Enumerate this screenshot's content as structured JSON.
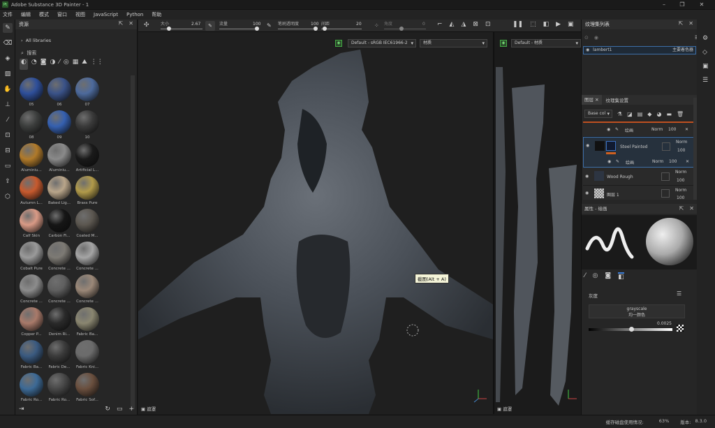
{
  "window": {
    "title": "Adobe Substance 3D Painter - 1",
    "logo": "Pt"
  },
  "menu": [
    "文件",
    "编辑",
    "模式",
    "窗口",
    "视图",
    "JavaScript",
    "Python",
    "帮助"
  ],
  "assets": {
    "title": "资源",
    "library": "All libraries",
    "search_placeholder": "搜索",
    "materials": [
      {
        "label": "05",
        "color": "#2e4f9a"
      },
      {
        "label": "06",
        "color": "#3a5288"
      },
      {
        "label": "07",
        "color": "#4d6a9c"
      },
      {
        "label": "08",
        "color": "#3c3e3d"
      },
      {
        "label": "09",
        "color": "#3560b0"
      },
      {
        "label": "10",
        "color": "#3a3a3a"
      },
      {
        "label": "Aluminiu...",
        "color": "#b07a2a"
      },
      {
        "label": "Aluminiu...",
        "color": "#8a8a8a"
      },
      {
        "label": "Artificial L...",
        "color": "#1a1a1a"
      },
      {
        "label": "Autumn L...",
        "color": "#c75a2e"
      },
      {
        "label": "Baked Lig...",
        "color": "#b9a58a"
      },
      {
        "label": "Brass Pure",
        "color": "#b19a4a"
      },
      {
        "label": "Calf Skin",
        "color": "#d99a86"
      },
      {
        "label": "Carbon Fi...",
        "color": "#161616"
      },
      {
        "label": "Coated M...",
        "color": "#5c5750"
      },
      {
        "label": "Cobalt Pure",
        "color": "#9a9a9a"
      },
      {
        "label": "Concrete ...",
        "color": "#7d7a74"
      },
      {
        "label": "Concrete ...",
        "color": "#a5a5a5"
      },
      {
        "label": "Concrete ...",
        "color": "#8c8c8c"
      },
      {
        "label": "Concrete ...",
        "color": "#5f5f5f"
      },
      {
        "label": "Concrete ...",
        "color": "#9b8878"
      },
      {
        "label": "Copper P...",
        "color": "#a97a6a"
      },
      {
        "label": "Denim Ri...",
        "color": "#2a2a2a"
      },
      {
        "label": "Fabric Ba...",
        "color": "#8a8670"
      },
      {
        "label": "Fabric Ba...",
        "color": "#3a5a80"
      },
      {
        "label": "Fabric De...",
        "color": "#3b3b3b"
      },
      {
        "label": "Fabric Kni...",
        "color": "#6b6b6b"
      },
      {
        "label": "Fabric Ro...",
        "color": "#3d6a96"
      },
      {
        "label": "Fabric Ro...",
        "color": "#474747"
      },
      {
        "label": "Fabric Sof...",
        "color": "#6a4f3e"
      }
    ]
  },
  "topbar": {
    "size_label": "大小",
    "size_value": "2.67",
    "flow_label": "流量",
    "flow_value": "100",
    "opacity_label": "笔刷透明度",
    "opacity_value": "100",
    "spacing_label": "间距",
    "spacing_value": "20",
    "angle_label": "角度",
    "angle_value": "0"
  },
  "viewport": {
    "colorspace": "Default - sRGB IEC61966-2",
    "mode": "材质",
    "colorspace2": "Default - 材质",
    "tooltip": "截图(Alt + A)",
    "mask_label": "遮罩",
    "mask_label2": "遮罩"
  },
  "texture_sets": {
    "title": "纹理集列表",
    "item": "lambert1",
    "shader": "主要着色器"
  },
  "layers": {
    "tab1": "图层",
    "tab2": "纹理集设置",
    "channel": "Base col",
    "rows": [
      {
        "name": "绘画",
        "blend": "Norm",
        "opacity": "100"
      },
      {
        "name": "Steel Painted",
        "blend": "Norm",
        "opacity": "100"
      },
      {
        "name": "绘画",
        "blend": "Norm",
        "opacity": "100"
      },
      {
        "name": "Wood Rough",
        "blend": "Norm",
        "opacity": "100"
      },
      {
        "name": "图层 1",
        "blend": "Norm",
        "opacity": "100"
      }
    ]
  },
  "properties": {
    "title": "属性 - 绘画",
    "section": "灰度",
    "gray_title": "grayscale",
    "gray_sub": "均一颜色",
    "gray_value": "0.0025"
  },
  "status": {
    "label": "缓存磁盘使用情况:",
    "percent": "63%",
    "version_label": "版本:",
    "version": "8.3.0"
  }
}
